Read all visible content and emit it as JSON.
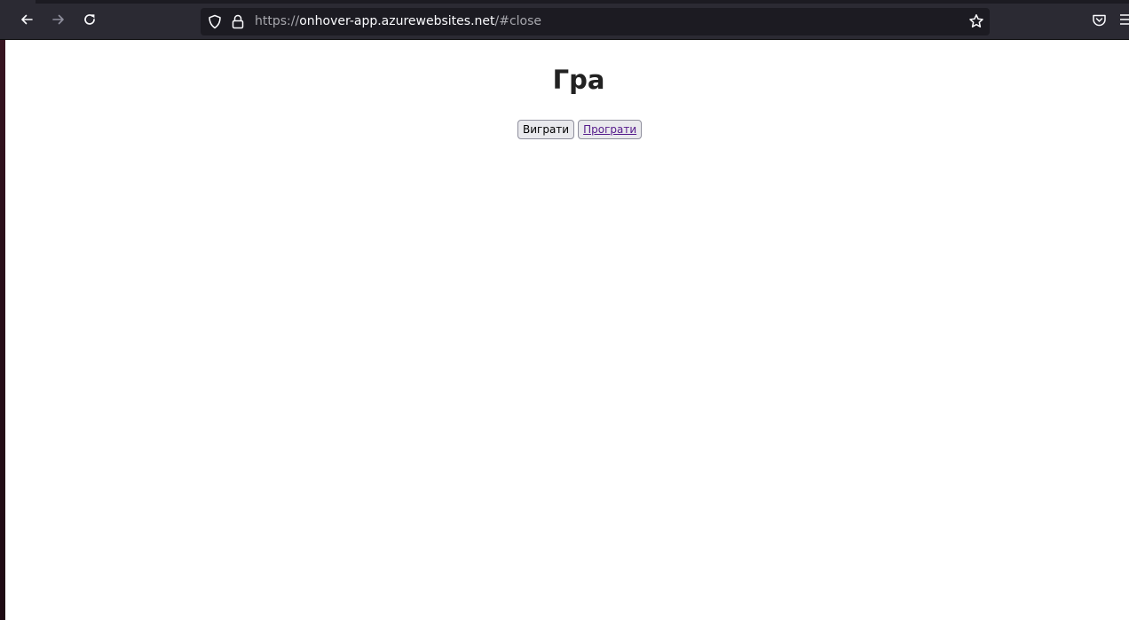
{
  "browser": {
    "url_scheme": "https://",
    "url_host": "onhover-app.azurewebsites.net",
    "url_path": "/#close",
    "icons": {
      "back": "back-arrow-icon",
      "forward": "forward-arrow-icon",
      "reload": "reload-icon",
      "tracking": "shield-icon",
      "secure": "lock-icon",
      "bookmark": "star-icon",
      "pocket": "pocket-icon",
      "menu": "hamburger-menu-icon"
    },
    "colors": {
      "toolbar": "#2b2a33",
      "urlbar": "#1c1b22",
      "icon": "#fbfbfe",
      "icon_disabled": "#8f8f9d"
    }
  },
  "page": {
    "title": "Гра",
    "buttons": [
      {
        "label": "Виграти"
      },
      {
        "label": "Програти"
      }
    ],
    "colors": {
      "title": "#222222",
      "link": "#551a8b",
      "button_bg": "#e9e9ed"
    }
  }
}
